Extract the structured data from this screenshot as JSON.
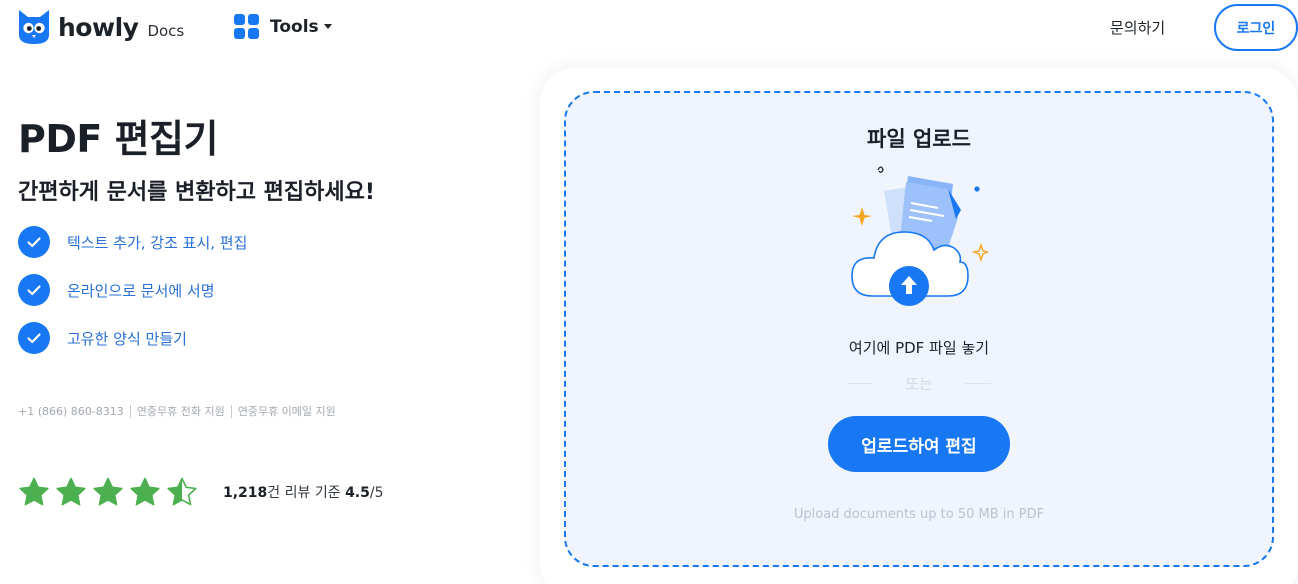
{
  "header": {
    "logo_word": "howly",
    "logo_sub": "Docs",
    "tools_label": "Tools",
    "contact_label": "문의하기",
    "login_label": "로그인"
  },
  "hero": {
    "title": "PDF 편집기",
    "subtitle": "간편하게 문서를 변환하고 편집하세요!",
    "features": [
      "텍스트 추가, 강조 표시, 편집",
      "온라인으로 문서에 서명",
      "고유한 양식 만들기"
    ],
    "phone": "+1 (866) 860-8313",
    "phone_support": "연중무휴 전화 지원",
    "email_support": "연중무휴 이메일 지원"
  },
  "rating": {
    "stars": 4.5,
    "count": "1,218",
    "count_suffix": "건 리뷰 기준",
    "score": "4.5",
    "out_of": "/5",
    "star_color": "#4caf50"
  },
  "upload": {
    "title": "파일 업로드",
    "drop_text": "여기에 PDF 파일 놓기",
    "or_text": "또는",
    "button_label": "업로드하여 편집",
    "note": "Upload documents up to 50 MB in PDF"
  },
  "colors": {
    "accent": "#1877f2",
    "feature_text": "#2970d6",
    "dropzone_bg": "#eff4fd"
  },
  "icons": {
    "logo": "owl-logo-icon",
    "tools": "grid-icon",
    "feature": "checkmark-icon",
    "rating": "star-icon",
    "upload": "cloud-upload-icon"
  }
}
